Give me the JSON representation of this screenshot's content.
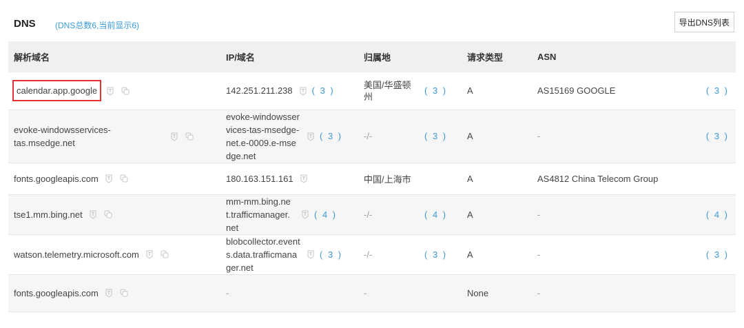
{
  "header": {
    "title": "DNS",
    "subtitle": "(DNS总数6,当前显示6)",
    "export_label": "导出DNS列表"
  },
  "columns": [
    "解析域名",
    "IP/域名",
    "归属地",
    "请求类型",
    "ASN"
  ],
  "rows": [
    {
      "domain": "calendar.app.google",
      "ip": "142.251.211.238",
      "ip_count": "( 3 )",
      "location": "美国/华盛顿州",
      "loc_count": "( 3 )",
      "type": "A",
      "asn": "AS15169 GOOGLE",
      "asn_count": "( 3 )",
      "highlighted": true
    },
    {
      "domain": "evoke-windowsservices-tas.msedge.net",
      "ip": "evoke-windowsservices-tas-msedge-net.e-0009.e-msedge.net",
      "ip_count": "( 3 )",
      "location": "-/-",
      "loc_count": "( 3 )",
      "type": "A",
      "asn": "-",
      "asn_count": "( 3 )"
    },
    {
      "domain": "fonts.googleapis.com",
      "ip": "180.163.151.161",
      "ip_count": "",
      "location": "中国/上海市",
      "loc_count": "",
      "type": "A",
      "asn": "AS4812 China Telecom Group",
      "asn_count": ""
    },
    {
      "domain": "tse1.mm.bing.net",
      "ip": "mm-mm.bing.net.trafficmanager.net",
      "ip_count": "( 4 )",
      "location": "-/-",
      "loc_count": "( 4 )",
      "type": "A",
      "asn": "-",
      "asn_count": "( 4 )"
    },
    {
      "domain": "watson.telemetry.microsoft.com",
      "ip": "blobcollector.events.data.trafficmanager.net",
      "ip_count": "( 3 )",
      "location": "-/-",
      "loc_count": "( 3 )",
      "type": "A",
      "asn": "-",
      "asn_count": "( 3 )"
    },
    {
      "domain": "fonts.googleapis.com",
      "ip": "-",
      "ip_count": "",
      "location": "-",
      "loc_count": "",
      "type": "None",
      "asn": "-",
      "asn_count": ""
    }
  ],
  "colors": {
    "accent": "#3a9bd9",
    "highlight": "#e2302f",
    "header_bg": "#eef0f2"
  },
  "icons": [
    "info-icon",
    "copy-icon"
  ]
}
